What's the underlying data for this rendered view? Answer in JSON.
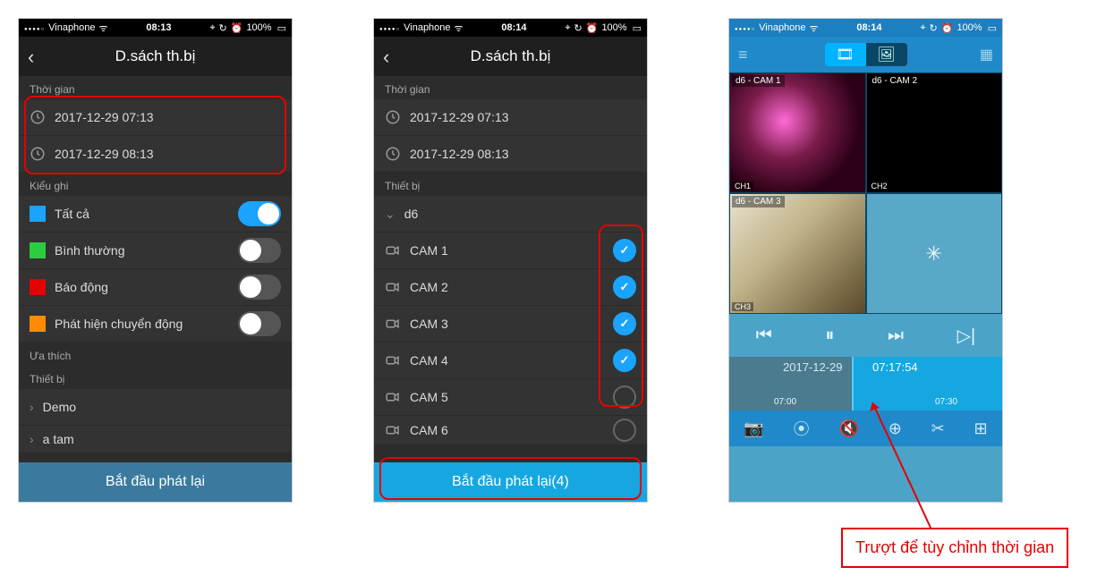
{
  "status1": {
    "carrier": "Vinaphone",
    "time": "08:13",
    "battery": "100%"
  },
  "status2": {
    "carrier": "Vinaphone",
    "time": "08:14",
    "battery": "100%"
  },
  "status3": {
    "carrier": "Vinaphone",
    "time": "08:14",
    "battery": "100%"
  },
  "nav": {
    "title": "D.sách th.bị"
  },
  "sections": {
    "time": "Thời gian",
    "recType": "Kiểu ghi",
    "fav": "Ưa thích",
    "device": "Thiết bị"
  },
  "times": {
    "start": "2017-12-29 07:13",
    "end": "2017-12-29 08:13"
  },
  "recTypes": {
    "all": {
      "label": "Tất cả",
      "color": "#1aa3ff",
      "on": true
    },
    "normal": {
      "label": "Bình thường",
      "color": "#2ecc40",
      "on": false
    },
    "alarm": {
      "label": "Báo động",
      "color": "#e60000",
      "on": false
    },
    "motion": {
      "label": "Phát hiện chuyển động",
      "color": "#ff8c00",
      "on": false
    }
  },
  "devices1": {
    "d0": "Demo",
    "d1": "a tam"
  },
  "button1": {
    "label": "Bắt đầu phát lại",
    "bg": "#3a7a9e"
  },
  "deviceGroup": "d6",
  "cams": {
    "c1": {
      "label": "CAM 1",
      "sel": true
    },
    "c2": {
      "label": "CAM 2",
      "sel": true
    },
    "c3": {
      "label": "CAM 3",
      "sel": true
    },
    "c4": {
      "label": "CAM 4",
      "sel": true
    },
    "c5": {
      "label": "CAM 5",
      "sel": false
    },
    "c6": {
      "label": "CAM 6",
      "sel": false
    }
  },
  "button2": {
    "label": "Bắt đầu phát lại(4)",
    "bg": "#17a7e0"
  },
  "grid": {
    "t1": "d6 - CAM 1",
    "t2": "d6 - CAM 2",
    "t3": "d6 - CAM 3",
    "ch1": "CH1",
    "ch2": "CH2",
    "ch3": "CH3"
  },
  "timeline": {
    "date": "2017-12-29",
    "now": "07:17:54",
    "t1": "07:00",
    "t2": "07:30"
  },
  "callout": "Trượt để tùy chỉnh thời gian"
}
